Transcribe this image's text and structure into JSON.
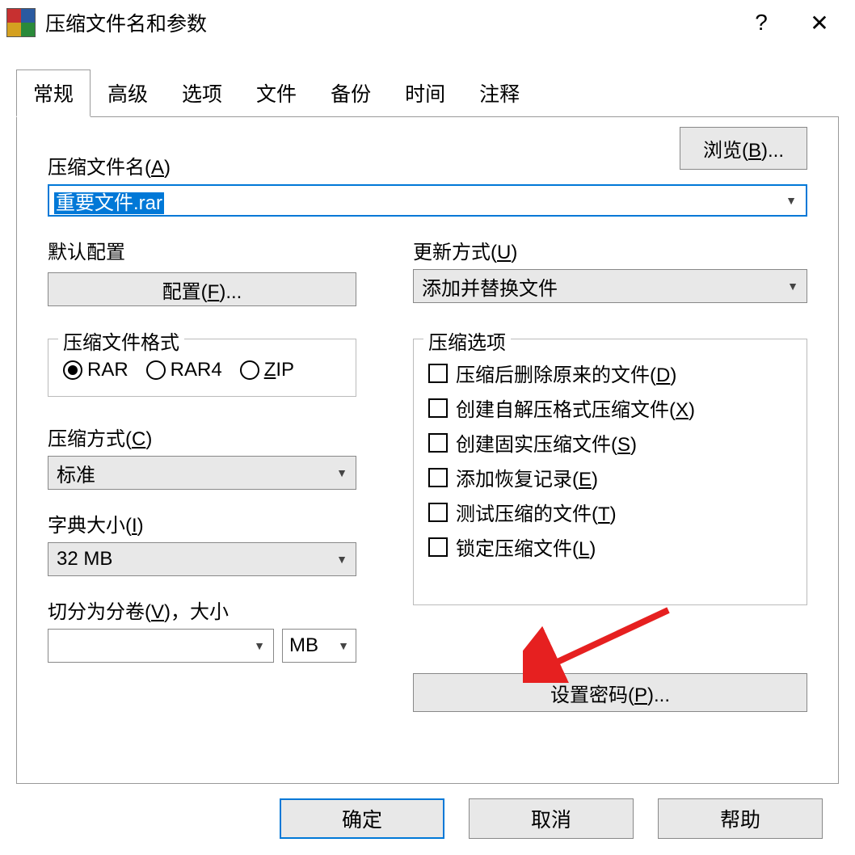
{
  "title": "压缩文件名和参数",
  "tabs": [
    "常规",
    "高级",
    "选项",
    "文件",
    "备份",
    "时间",
    "注释"
  ],
  "archive_name_label": "压缩文件名(A)",
  "archive_name_value": "重要文件.rar",
  "browse_label": "浏览(B)...",
  "profile": {
    "label": "默认配置",
    "button": "配置(F)..."
  },
  "update_mode": {
    "label": "更新方式(U)",
    "value": "添加并替换文件"
  },
  "format": {
    "legend": "压缩文件格式",
    "options": [
      "RAR",
      "RAR4",
      "ZIP"
    ],
    "selected": "RAR"
  },
  "method": {
    "label": "压缩方式(C)",
    "value": "标准"
  },
  "dict": {
    "label": "字典大小(I)",
    "value": "32 MB"
  },
  "split": {
    "label": "切分为分卷(V)，大小",
    "value": "",
    "unit": "MB"
  },
  "options": {
    "legend": "压缩选项",
    "items": [
      {
        "label": "压缩后删除原来的文件(D)",
        "u": "D"
      },
      {
        "label": "创建自解压格式压缩文件(X)",
        "u": "X"
      },
      {
        "label": "创建固实压缩文件(S)",
        "u": "S"
      },
      {
        "label": "添加恢复记录(E)",
        "u": "E"
      },
      {
        "label": "测试压缩的文件(T)",
        "u": "T"
      },
      {
        "label": "锁定压缩文件(L)",
        "u": "L"
      }
    ]
  },
  "password_btn": "设置密码(P)...",
  "footer": {
    "ok": "确定",
    "cancel": "取消",
    "help": "帮助"
  }
}
